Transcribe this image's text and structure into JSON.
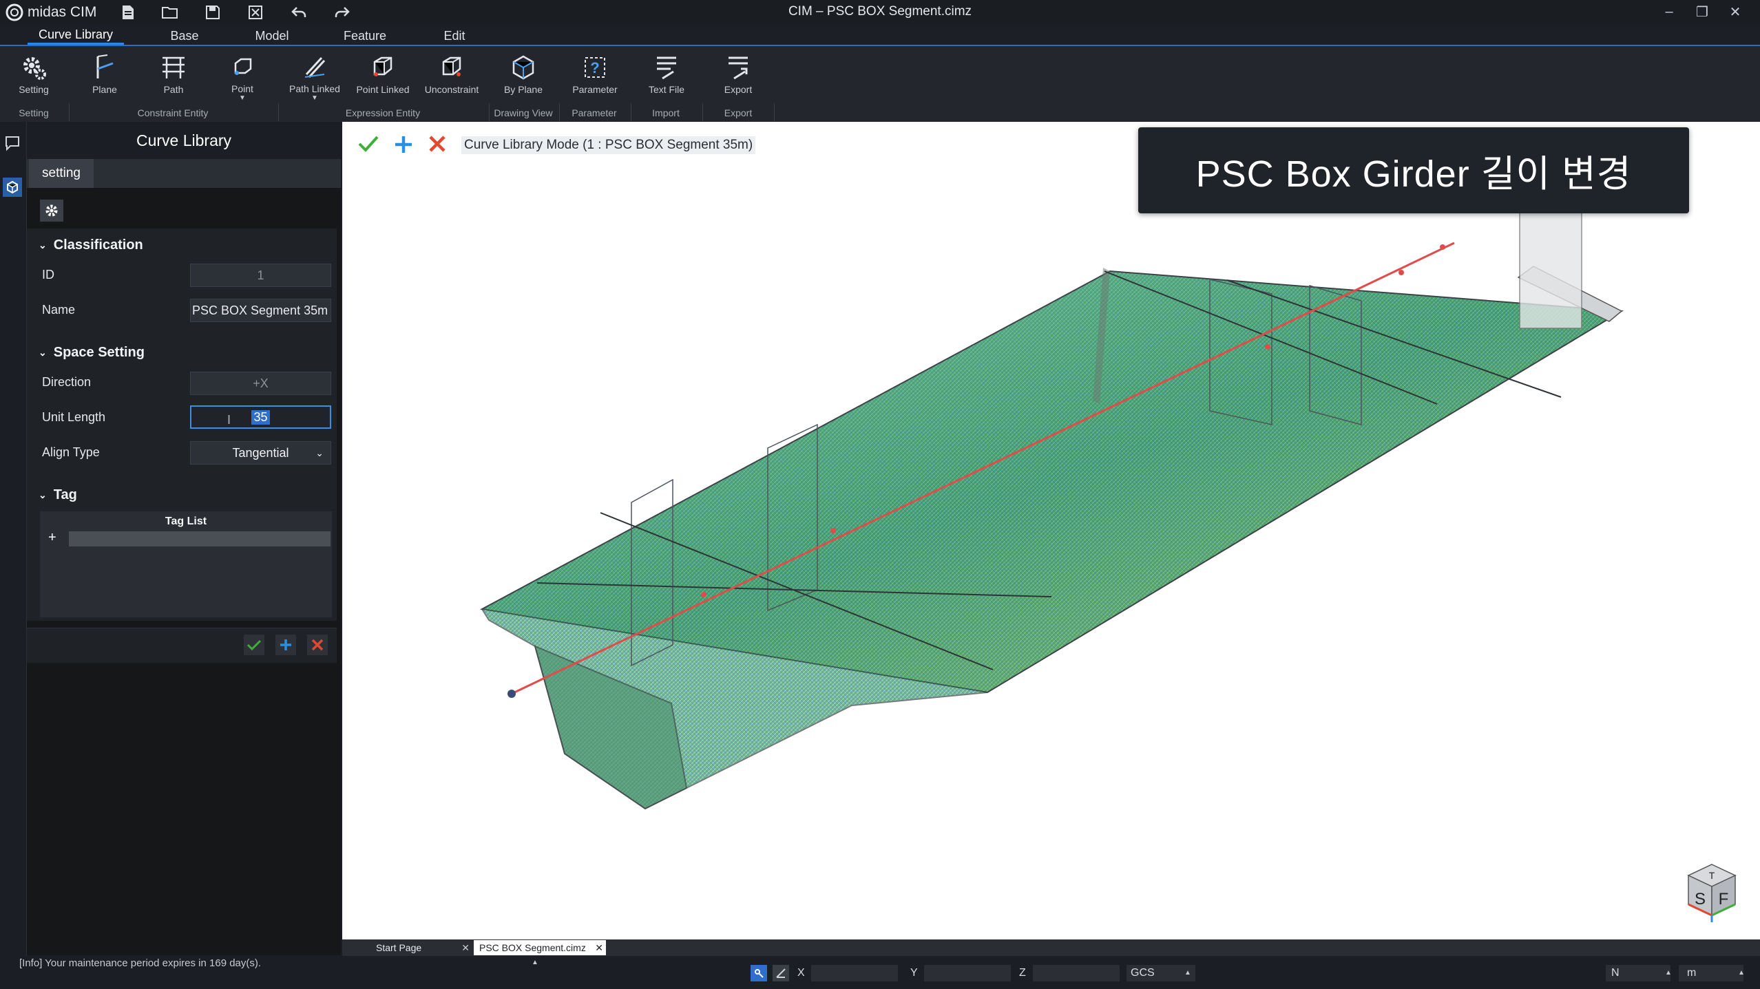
{
  "app": {
    "name": "midas CIM",
    "window_title": "CIM – PSC BOX Segment.cimz"
  },
  "menu": {
    "tabs": [
      {
        "label": "Curve Library"
      },
      {
        "label": "Base"
      },
      {
        "label": "Model"
      },
      {
        "label": "Feature"
      },
      {
        "label": "Edit"
      }
    ],
    "active": "Curve Library"
  },
  "ribbon": {
    "buttons": [
      {
        "label": "Setting"
      },
      {
        "label": "Plane"
      },
      {
        "label": "Path"
      },
      {
        "label": "Point"
      },
      {
        "label": "Path Linked"
      },
      {
        "label": "Point Linked"
      },
      {
        "label": "Unconstraint"
      },
      {
        "label": "By Plane"
      },
      {
        "label": "Parameter"
      },
      {
        "label": "Text File"
      },
      {
        "label": "Export"
      }
    ],
    "groups": [
      {
        "label": "Setting"
      },
      {
        "label": "Constraint Entity"
      },
      {
        "label": "Expression Entity"
      },
      {
        "label": "Drawing View"
      },
      {
        "label": "Parameter"
      },
      {
        "label": "Import"
      },
      {
        "label": "Export"
      }
    ]
  },
  "panel": {
    "title": "Curve Library",
    "tab": "setting",
    "sections": {
      "classification": "Classification",
      "space_setting": "Space Setting",
      "tag": "Tag"
    },
    "fields": {
      "id_label": "ID",
      "id_value": "1",
      "name_label": "Name",
      "name_value": "PSC BOX Segment 35m",
      "direction_label": "Direction",
      "direction_value": "+X",
      "unit_length_label": "Unit Length",
      "unit_length_value": "35",
      "align_type_label": "Align Type",
      "align_type_value": "Tangential"
    },
    "tag_list_header": "Tag List",
    "tag_add": "+"
  },
  "viewport": {
    "mode_text": "Curve Library Mode (1 : PSC BOX Segment 35m)",
    "caption": "PSC Box Girder 길이 변경",
    "view_cube": {
      "top": "T",
      "left": "S",
      "right": "F"
    }
  },
  "doc_tabs": [
    {
      "label": "Start Page"
    },
    {
      "label": "PSC BOX Segment.cimz"
    }
  ],
  "status": {
    "info": "[Info] Your maintenance period expires in 169 day(s).",
    "x_label": "X",
    "y_label": "Y",
    "z_label": "Z",
    "coord_system": "GCS",
    "force_unit": "N",
    "length_unit": "m"
  },
  "colors": {
    "accent": "#2f86e8",
    "confirm": "#3fae3a",
    "cancel": "#e2472f",
    "add": "#2b8fe0"
  }
}
